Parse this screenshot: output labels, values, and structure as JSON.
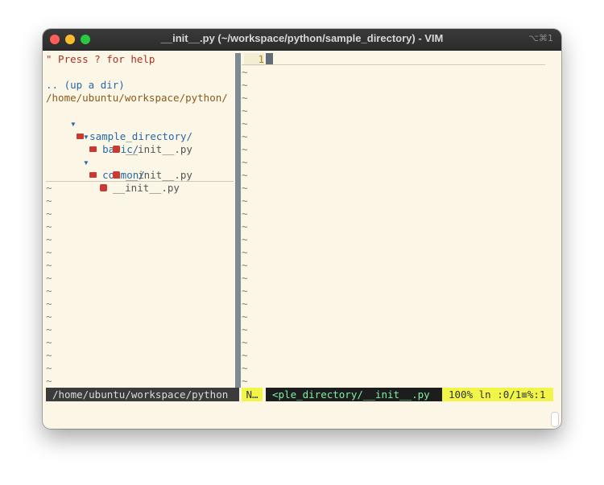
{
  "window": {
    "title": "__init__.py (~/workspace/python/sample_directory) - VIM",
    "shortcut": "⌥⌘1"
  },
  "nerdtree": {
    "help_line": "\" Press ? for help",
    "up_dir": ".. (up a dir)",
    "root_path": "/home/ubuntu/workspace/python/",
    "tree": [
      {
        "label": "sample_directory/",
        "type": "dir"
      },
      {
        "label": "basic/",
        "type": "dir"
      },
      {
        "label": "__init__.py",
        "type": "file"
      },
      {
        "label": "common/",
        "type": "dir"
      },
      {
        "label": "__init__.py",
        "type": "file"
      },
      {
        "label": "__init__.py",
        "type": "file"
      }
    ],
    "tilde": "~",
    "arrow_down": "▾"
  },
  "editor": {
    "line_number": "1"
  },
  "statusline": {
    "left_path": "/home/ubuntu/workspace/python",
    "mode": "N…",
    "file": "<ple_directory/__init__.py",
    "position": "100%  ln :0/1≡%:1"
  },
  "colors": {
    "background": "#fbf6e6",
    "comment_red": "#b03020",
    "dir_blue": "#2569a8",
    "file_gray": "#555555",
    "status_yellow": "#f1f54a",
    "status_green_text": "#7df0a8"
  }
}
